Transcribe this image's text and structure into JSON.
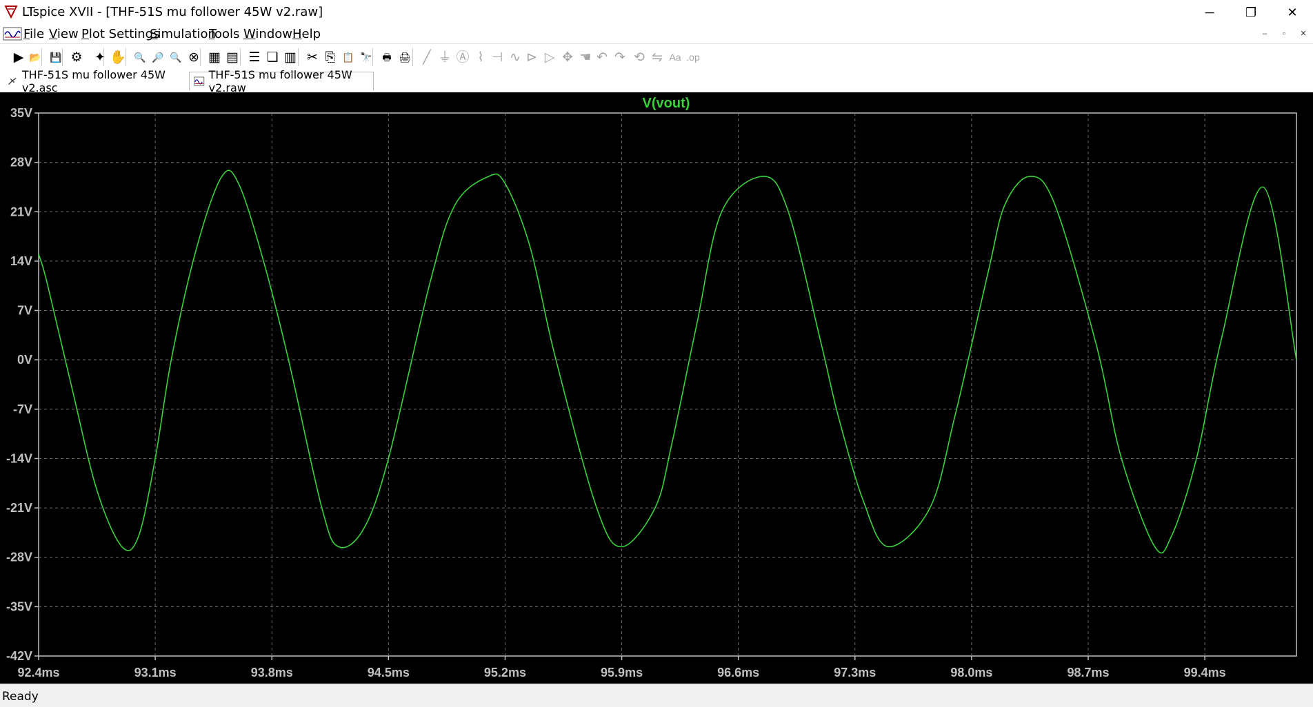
{
  "window": {
    "title": "LTspice XVII - [THF-51S mu follower 45W v2.raw]",
    "minimize_glyph": "─",
    "restore_glyph": "❐",
    "close_glyph": "✕",
    "mdi_minimize": "–",
    "mdi_restore": "▫",
    "mdi_close": "✕"
  },
  "menu": {
    "items": [
      {
        "key": "F",
        "rest": "ile"
      },
      {
        "key": "V",
        "rest": "iew"
      },
      {
        "key": "P",
        "rest": "lot Settings"
      },
      {
        "key": "S",
        "rest": "imulation"
      },
      {
        "key": "T",
        "rest": "ools"
      },
      {
        "key": "W",
        "rest": "indow"
      },
      {
        "key": "H",
        "rest": "elp"
      }
    ]
  },
  "toolbar": {
    "buttons": [
      {
        "name": "run-icon",
        "glyph": "▶"
      },
      {
        "name": "open-icon",
        "glyph": "📂"
      },
      {
        "name": "save-icon",
        "glyph": "💾"
      },
      {
        "name": "control-panel-icon",
        "glyph": "⚙"
      },
      {
        "name": "halt-icon",
        "glyph": "✦"
      },
      {
        "name": "pan-icon",
        "glyph": "✋"
      },
      {
        "name": "zoom-in-icon",
        "glyph": "🔍"
      },
      {
        "name": "zoom-out-icon",
        "glyph": "🔎"
      },
      {
        "name": "zoom-back-icon",
        "glyph": "🔍"
      },
      {
        "name": "zoom-fit-icon",
        "glyph": "⊗"
      },
      {
        "name": "autorange-icon",
        "glyph": "▦"
      },
      {
        "name": "autorange-y-icon",
        "glyph": "▤"
      },
      {
        "name": "tile-horizontal-icon",
        "glyph": "☰"
      },
      {
        "name": "cascade-icon",
        "glyph": "❏"
      },
      {
        "name": "tile-vertical-icon",
        "glyph": "▥"
      },
      {
        "name": "cut-icon",
        "glyph": "✂"
      },
      {
        "name": "copy-icon",
        "glyph": "⎘"
      },
      {
        "name": "paste-icon",
        "glyph": "📋"
      },
      {
        "name": "find-icon",
        "glyph": "🔭"
      },
      {
        "name": "print-icon",
        "glyph": "🖶"
      },
      {
        "name": "print-setup-icon",
        "glyph": "🖨"
      },
      {
        "name": "wire-icon",
        "glyph": "╱"
      },
      {
        "name": "ground-icon",
        "glyph": "⏚"
      },
      {
        "name": "label-net-icon",
        "glyph": "Ⓐ"
      },
      {
        "name": "resistor-icon",
        "glyph": "⌇"
      },
      {
        "name": "capacitor-icon",
        "glyph": "⊣"
      },
      {
        "name": "inductor-icon",
        "glyph": "∿"
      },
      {
        "name": "diode-icon",
        "glyph": "⊳"
      },
      {
        "name": "component-icon",
        "glyph": "▷"
      },
      {
        "name": "move-icon",
        "glyph": "✥"
      },
      {
        "name": "drag-icon",
        "glyph": "☚"
      },
      {
        "name": "undo-icon",
        "glyph": "↶"
      },
      {
        "name": "redo-icon",
        "glyph": "↷"
      },
      {
        "name": "rotate-icon",
        "glyph": "⟲"
      },
      {
        "name": "mirror-icon",
        "glyph": "⇋"
      },
      {
        "name": "text-icon",
        "glyph": "Aa"
      },
      {
        "name": "spice-directive-icon",
        "glyph": ".op"
      }
    ]
  },
  "tabs": [
    {
      "label": "THF-51S mu follower 45W v2.asc"
    },
    {
      "label": "THF-51S mu follower 45W v2.raw"
    }
  ],
  "status": {
    "text": "Ready"
  },
  "colors": {
    "trace": "#3ad23a",
    "grid": "#6e6e6e",
    "axis_text": "#c0c0c0",
    "background": "#000000"
  },
  "chart_data": {
    "type": "line",
    "title": "V(vout)",
    "xlabel": "",
    "ylabel": "",
    "x_unit": "ms",
    "y_unit": "V",
    "xlim": [
      92.4,
      99.95
    ],
    "ylim": [
      -42,
      35
    ],
    "x_ticks": [
      "92.4ms",
      "93.1ms",
      "93.8ms",
      "94.5ms",
      "95.2ms",
      "95.9ms",
      "96.6ms",
      "97.3ms",
      "98.0ms",
      "98.7ms",
      "99.4ms"
    ],
    "y_ticks": [
      "35V",
      "28V",
      "21V",
      "14V",
      "7V",
      "0V",
      "-7V",
      "-14V",
      "-21V",
      "-28V",
      "-35V",
      "-42V"
    ],
    "grid": true,
    "series": [
      {
        "name": "V(vout)",
        "description": "sinusoid, 1 kHz, amplitude ~26.5 V, offset ~-0.3 V",
        "x_ms": [
          92.4,
          92.45,
          92.6,
          92.75,
          92.9,
          93.0,
          93.1,
          93.2,
          93.35,
          93.5,
          93.6,
          93.75,
          93.9,
          94.1,
          94.2,
          94.35,
          94.5,
          94.75,
          94.9,
          95.1,
          95.2,
          95.35,
          95.5,
          95.75,
          95.9,
          96.1,
          96.2,
          96.35,
          96.5,
          96.75,
          96.9,
          97.1,
          97.2,
          97.35,
          97.5,
          97.75,
          97.9,
          98.1,
          98.2,
          98.35,
          98.5,
          98.75,
          98.9,
          99.1,
          99.2,
          99.35,
          99.5,
          99.75,
          99.95
        ],
        "y_V": [
          15.0,
          11.0,
          -4.0,
          -18.5,
          -26.5,
          -25.0,
          -14.0,
          0.5,
          16.0,
          26.0,
          25.0,
          14.0,
          0.0,
          -21.0,
          -26.5,
          -24.0,
          -14.0,
          11.0,
          22.0,
          26.0,
          25.0,
          16.0,
          0.5,
          -21.0,
          -26.5,
          -21.0,
          -12.0,
          5.0,
          21.0,
          26.0,
          21.0,
          2.0,
          -8.0,
          -20.0,
          -26.5,
          -21.0,
          -8.0,
          12.5,
          22.0,
          26.0,
          22.0,
          2.0,
          -14.0,
          -26.5,
          -25.0,
          -14.0,
          3.0,
          24.5,
          0.0
        ]
      }
    ]
  }
}
